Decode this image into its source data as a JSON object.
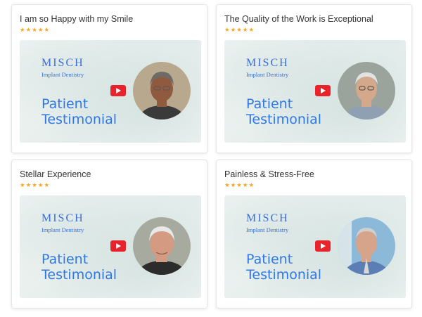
{
  "cards": [
    {
      "title": "I am so Happy with my Smile",
      "stars": "★★★★★",
      "video": {
        "brand": "MISCH",
        "brand_sub": "Implant Dentistry",
        "headline_line1": "Patient",
        "headline_line2": "Testimonial",
        "avatar_icon": "patient-photo",
        "play_icon": "youtube-play-icon"
      },
      "colors": {
        "bg": "#b8a98e",
        "skin": "#8f5a3e",
        "hair": "#6e6a66",
        "shirt": "#3a3a3a"
      }
    },
    {
      "title": "The Quality of the Work is Exceptional",
      "stars": "★★★★★",
      "video": {
        "brand": "MISCH",
        "brand_sub": "Implant Dentistry",
        "headline_line1": "Patient",
        "headline_line2": "Testimonial",
        "avatar_icon": "patient-photo",
        "play_icon": "youtube-play-icon"
      },
      "colors": {
        "bg": "#9aa39c",
        "skin": "#d4a88a",
        "hair": "#e2e2e2",
        "shirt": "#8fa0b3"
      }
    },
    {
      "title": "Stellar Experience",
      "stars": "★★★★★",
      "video": {
        "brand": "MISCH",
        "brand_sub": "Implant Dentistry",
        "headline_line1": "Patient",
        "headline_line2": "Testimonial",
        "avatar_icon": "patient-photo",
        "play_icon": "youtube-play-icon"
      },
      "colors": {
        "bg": "#a7ab9f",
        "skin": "#d49a82",
        "hair": "#e8e8e8",
        "shirt": "#2c2c2c"
      }
    },
    {
      "title": "Painless & Stress-Free",
      "stars": "★★★★★",
      "video": {
        "brand": "MISCH",
        "brand_sub": "Implant Dentistry",
        "headline_line1": "Patient",
        "headline_line2": "Testimonial",
        "avatar_icon": "patient-photo",
        "play_icon": "youtube-play-icon"
      },
      "colors": {
        "bg": "#8cb9d8",
        "skin": "#d6a48b",
        "hair": "#cfcfcf",
        "shirt": "#5b7fb5"
      }
    }
  ]
}
